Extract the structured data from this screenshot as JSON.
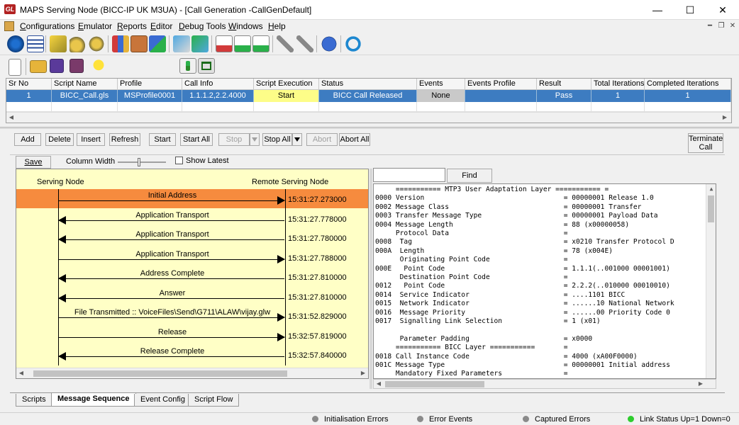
{
  "window": {
    "title": "MAPS Serving Node (BICC-IP UK M3UA) - [Call Generation  -CallGenDefault]",
    "app_icon_text": "GL",
    "controls": [
      "—",
      "☐",
      "✕"
    ]
  },
  "menu": [
    {
      "label": "Configurations",
      "ul": "C",
      "rest": "onfigurations"
    },
    {
      "label": "Emulator",
      "ul": "E",
      "rest": "mulator"
    },
    {
      "label": "Reports",
      "ul": "R",
      "rest": "eports"
    },
    {
      "label": "Editor",
      "ul": "E",
      "rest": "ditor"
    },
    {
      "label": "Debug Tools",
      "ul": "D",
      "rest": "ebug Tools"
    },
    {
      "label": "Windows",
      "ul": "W",
      "rest": "indows"
    },
    {
      "label": "Help",
      "ul": "H",
      "rest": "elp"
    }
  ],
  "grid": {
    "headers": [
      "Sr No",
      "Script Name",
      "Profile",
      "Call Info",
      "Script Execution",
      "Status",
      "Events",
      "Events Profile",
      "Result",
      "Total Iterations",
      "Completed Iterations"
    ],
    "row": [
      "1",
      "BICC_Call.gls",
      "MSProfile0001",
      "1.1.1.2,2.2.4000",
      "Start",
      "BICC Call Released",
      "None",
      "",
      "Pass",
      "1",
      "1"
    ]
  },
  "controls": {
    "add": "Add",
    "delete": "Delete",
    "insert": "Insert",
    "refresh": "Refresh",
    "start": "Start",
    "start_all": "Start All",
    "stop": "Stop",
    "stop_all": "Stop All",
    "abort": "Abort",
    "abort_all": "Abort All",
    "terminate_1": "Terminate",
    "terminate_2": "Call",
    "save": "Save",
    "column_width": "Column Width",
    "show_latest": "Show Latest",
    "find": "Find",
    "find_value": ""
  },
  "sequence": {
    "left_node": "Serving Node",
    "right_node": "Remote Serving Node",
    "messages": [
      {
        "label": "Initial Address",
        "dir": "right",
        "time": "15:31:27.273000",
        "selected": true
      },
      {
        "label": "Application Transport",
        "dir": "left",
        "time": "15:31:27.778000",
        "selected": false
      },
      {
        "label": "Application Transport",
        "dir": "left",
        "time": "15:31:27.780000",
        "selected": false
      },
      {
        "label": "Application Transport",
        "dir": "right",
        "time": "15:31:27.788000",
        "selected": false
      },
      {
        "label": "Address Complete",
        "dir": "left",
        "time": "15:31:27.810000",
        "selected": false
      },
      {
        "label": "Answer",
        "dir": "left",
        "time": "15:31:27.810000",
        "selected": false
      },
      {
        "label": "File Transmitted :: VoiceFiles\\Send\\G711\\ALAW\\vijay.glw",
        "dir": "right",
        "time": "15:31:52.829000",
        "selected": false
      },
      {
        "label": "Release",
        "dir": "right",
        "time": "15:32:57.819000",
        "selected": false
      },
      {
        "label": "Release Complete",
        "dir": "left",
        "time": "15:32:57.840000",
        "selected": false
      }
    ]
  },
  "decode_lines": [
    "     =========== MTP3 User Adaptation Layer =========== =",
    "0000 Version                                  = 00000001 Release 1.0",
    "0002 Message Class                            = 00000001 Transfer",
    "0003 Transfer Message Type                    = 00000001 Payload Data",
    "0004 Message Length                           = 88 (x00000058)",
    "     Protocol Data                            =",
    "0008  Tag                                     = x0210 Transfer Protocol D",
    "000A  Length                                  = 78 (x004E)",
    "      Originating Point Code                  =",
    "000E   Point Code                             = 1.1.1(..001000 00001001)",
    "      Destination Point Code                  =",
    "0012   Point Code                             = 2.2.2(..010000 00010010)",
    "0014  Service Indicator                       = ....1101 BICC",
    "0015  Network Indicator                       = ......10 National Network",
    "0016  Message Priority                        = ......00 Priority Code 0",
    "0017  Signalling Link Selection               = 1 (x01)",
    "",
    "      Parameter Padding                       = x0000",
    "     =========== BICC Layer ===========       =",
    "0018 Call Instance Code                       = 4000 (xA00F0000)",
    "001C Message Type                             = 00000001 Initial address",
    "     Mandatory Fixed Parameters               ="
  ],
  "tabs": [
    "Scripts",
    "Message Sequence",
    "Event Config",
    "Script Flow"
  ],
  "status": [
    {
      "label": "Initialisation Errors",
      "color": "#8a8a8a"
    },
    {
      "label": "Error Events",
      "color": "#8a8a8a"
    },
    {
      "label": "Captured Errors",
      "color": "#8a8a8a"
    },
    {
      "label": "Link Status Up=1 Down=0",
      "color": "#2ecc2e"
    }
  ]
}
